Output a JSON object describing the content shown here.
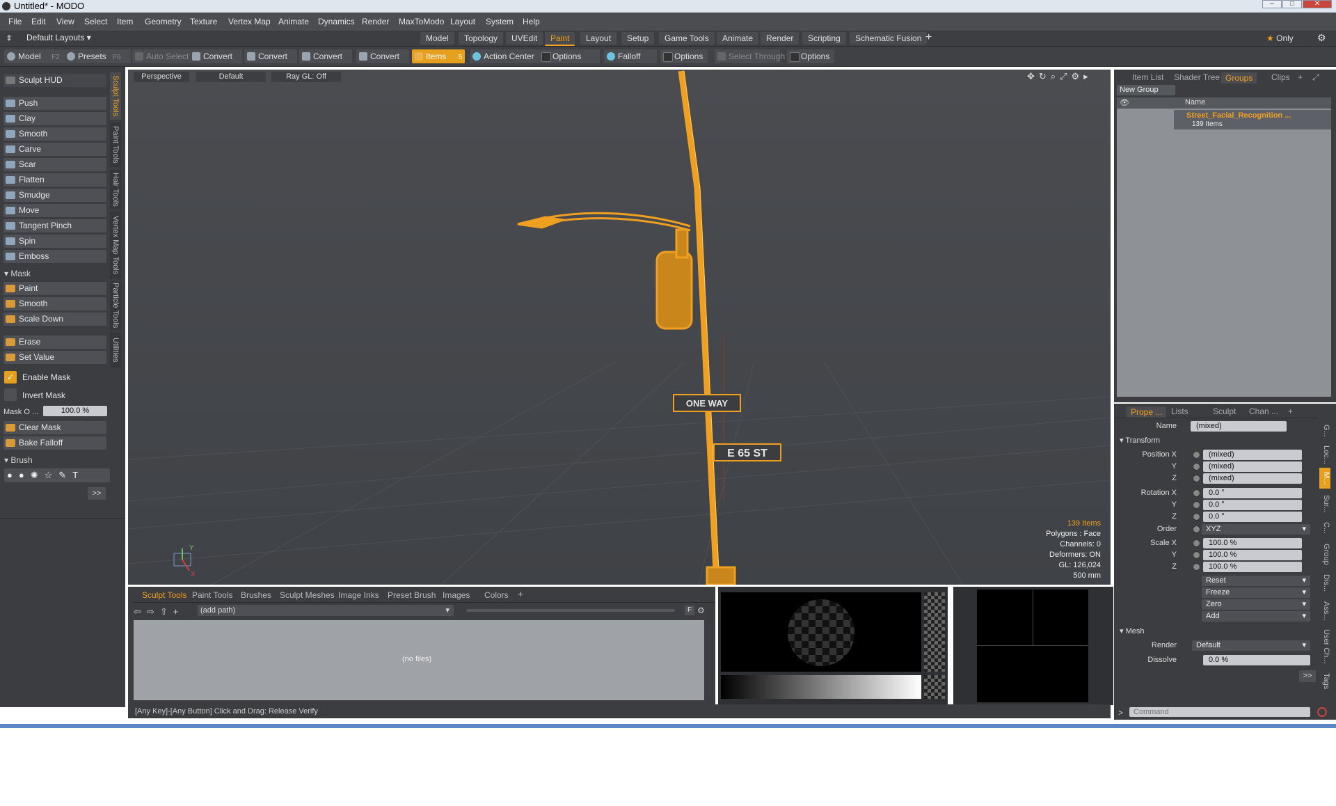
{
  "window": {
    "title": "Untitled* - MODO"
  },
  "menu": [
    "File",
    "Edit",
    "View",
    "Select",
    "Item",
    "Geometry",
    "Texture",
    "Vertex Map",
    "Animate",
    "Dynamics",
    "Render",
    "MaxToModo",
    "Layout",
    "System",
    "Help"
  ],
  "layouts": {
    "selector": "Default Layouts",
    "tabs": [
      "Model",
      "Topology",
      "UVEdit",
      "Paint",
      "Layout",
      "Setup",
      "Game Tools",
      "Animate",
      "Render",
      "Scripting",
      "Schematic Fusion"
    ],
    "active": "Paint",
    "only_label": "Only"
  },
  "toolbar": {
    "model": "Model",
    "model_key": "F2",
    "presets": "Presets",
    "presets_key": "F6",
    "auto_select": "Auto Select",
    "convert": "Convert",
    "items": "Items",
    "items_key": "5",
    "action_center": "Action Center",
    "options": "Options",
    "falloff": "Falloff",
    "select_through": "Select Through"
  },
  "sculpt": {
    "hud": "Sculpt HUD",
    "tools": [
      "Push",
      "Clay",
      "Smooth",
      "Carve",
      "Scar",
      "Flatten",
      "Smudge",
      "Move",
      "Tangent Pinch",
      "Spin",
      "Emboss"
    ],
    "mask_header": "Mask",
    "mask_tools": [
      "Paint",
      "Smooth",
      "Scale Down"
    ],
    "erase": "Erase",
    "set_value": "Set Value",
    "enable_mask": "Enable Mask",
    "invert_mask": "Invert Mask",
    "mask_opacity_label": "Mask O ...",
    "mask_opacity_value": "100.0 %",
    "clear_mask": "Clear Mask",
    "bake_falloff": "Bake Falloff",
    "brush_header": "Brush",
    "more": ">>"
  },
  "side_tabs": [
    "Sculpt Tools",
    "Paint Tools",
    "Hair Tools",
    "Vertex Map Tools",
    "Particle Tools",
    "Utilities"
  ],
  "viewport": {
    "view": "Perspective",
    "shading": "Default",
    "raygl": "Ray GL: Off",
    "sign1": "ONE WAY",
    "sign2": "E 65 ST",
    "stats": {
      "items": "139 Items",
      "polygons": "Polygons : Face",
      "channels": "Channels: 0",
      "deformers": "Deformers: ON",
      "gl": "GL: 126,024",
      "size": "500 mm"
    },
    "axis_y": "Y",
    "axis_x": "X"
  },
  "bottom": {
    "tabs": [
      "Sculpt Tools",
      "Paint Tools",
      "Brushes",
      "Sculpt Meshes",
      "Image Inks",
      "Preset Brush",
      "Images",
      "Colors"
    ],
    "path": "(add path)",
    "empty": "(no files)",
    "f_btn": "F"
  },
  "status": "[Any Key]-[Any Button] Click and Drag:  Release Verify",
  "groups_panel": {
    "tabs": [
      "Item List",
      "Shader Tree",
      "Groups",
      "Clips"
    ],
    "active": "Groups",
    "new_group": "New Group",
    "col_name": "Name",
    "group_name": "Street_Facial_Recognition ...",
    "group_count": "139 Items"
  },
  "properties": {
    "tabs": [
      "Prope ...",
      "Lists",
      "Sculpt",
      "Chan ..."
    ],
    "name_label": "Name",
    "name_value": "(mixed)",
    "transform": "Transform",
    "position_x_label": "Position X",
    "y_label": "Y",
    "z_label": "Z",
    "pos": [
      "(mixed)",
      "(mixed)",
      "(mixed)"
    ],
    "rotation_x_label": "Rotation X",
    "rot": [
      "0.0 °",
      "0.0 °",
      "0.0 °"
    ],
    "order_label": "Order",
    "order_value": "XYZ",
    "scale_x_label": "Scale X",
    "scale": [
      "100.0 %",
      "100.0 %",
      "100.0 %"
    ],
    "actions": [
      "Reset",
      "Freeze",
      "Zero",
      "Add"
    ],
    "mesh": "Mesh",
    "render_label": "Render",
    "render_value": "Default",
    "dissolve_label": "Dissolve",
    "dissolve_value": "0.0 %",
    "more": ">>"
  },
  "right_side_tabs": [
    "G...",
    "Loc...",
    "M...",
    "Sur...",
    "C...",
    "Group",
    "Dis...",
    "Ass...",
    "User Ch...",
    "Tags"
  ],
  "command": {
    "placeholder": "Command"
  }
}
